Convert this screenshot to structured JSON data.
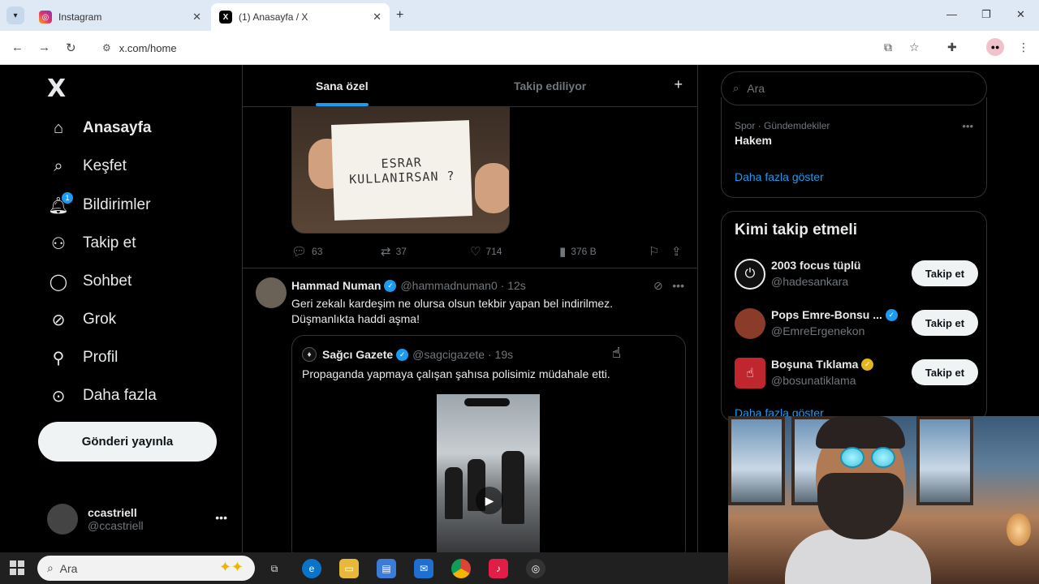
{
  "browser": {
    "tabs": [
      {
        "title": "Instagram",
        "active": false
      },
      {
        "title": "(1) Anasayfa / X",
        "active": true
      }
    ],
    "url": "x.com/home",
    "close_glyph": "✕"
  },
  "sidebar": {
    "logo": "X",
    "items": [
      {
        "label": "Anasayfa",
        "icon": "home-icon",
        "active": true
      },
      {
        "label": "Keşfet",
        "icon": "search-icon"
      },
      {
        "label": "Bildirimler",
        "icon": "bell-icon",
        "badge": "1"
      },
      {
        "label": "Takip et",
        "icon": "person-add-icon"
      },
      {
        "label": "Sohbet",
        "icon": "chat-icon"
      },
      {
        "label": "Grok",
        "icon": "grok-icon"
      },
      {
        "label": "Profil",
        "icon": "person-icon"
      },
      {
        "label": "Daha fazla",
        "icon": "more-circle-icon"
      }
    ],
    "post_button": "Gönderi yayınla",
    "account": {
      "name": "ccastriell",
      "handle": "@ccastriell"
    }
  },
  "feed": {
    "tabs": [
      "Sana özel",
      "Takip ediliyor"
    ],
    "first_post": {
      "image_text_line1": "ESRAR",
      "image_text_line2": "KULLANIRSAN ?",
      "replies": "63",
      "reposts": "37",
      "likes": "714",
      "views": "376 B"
    },
    "tweet": {
      "name": "Hammad Numan",
      "handle": "@hammadnuman0",
      "time": "· 12s",
      "text_line1": "Geri zekalı kardeşim ne olursa olsun tekbir yapan bel indirilmez.",
      "text_line2": "Düşmanlıkta haddi aşma!",
      "quote": {
        "name": "Sağcı Gazete",
        "handle": "@sagcigazete",
        "time": "· 19s",
        "text": "Propaganda yapmaya çalışan şahısa polisimiz müdahale etti."
      }
    }
  },
  "right": {
    "search_placeholder": "Ara",
    "trend": {
      "category": "Spor · Gündemdekiler",
      "name": "Hakem",
      "show_more": "Daha fazla göster"
    },
    "who_to_follow": {
      "title": "Kimi takip etmeli",
      "users": [
        {
          "name": "2003 focus tüplü",
          "handle": "@hadesankara",
          "button": "Takip et",
          "color": "#111111",
          "badge": "none"
        },
        {
          "name": "Pops Emre-Bonsu ...",
          "handle": "@EmreErgenekon",
          "button": "Takip et",
          "color": "#8a3b2a",
          "badge": "blue"
        },
        {
          "name": "Boşuna Tıklama",
          "handle": "@bosunatiklama",
          "button": "Takip et",
          "color": "#c0262d",
          "badge": "gold"
        }
      ],
      "show_more": "Daha fazla göster"
    }
  },
  "taskbar": {
    "search_placeholder": "Ara"
  }
}
